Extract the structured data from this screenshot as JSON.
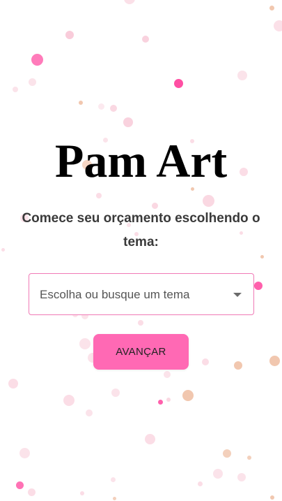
{
  "header": {
    "title": "Pam Art",
    "subtitle": "Comece seu orçamento escolhendo o tema:"
  },
  "theme_select": {
    "placeholder": "Escolha ou busque um tema",
    "icon": "chevron-down-icon"
  },
  "actions": {
    "next_label": "AVANÇAR"
  },
  "colors": {
    "accent": "#ff69b4",
    "input_border": "#f07ab6",
    "confetti_pink": "#ff4fa3",
    "confetti_peach": "#e8a27a",
    "confetti_light_pink": "#f8c7d6"
  }
}
